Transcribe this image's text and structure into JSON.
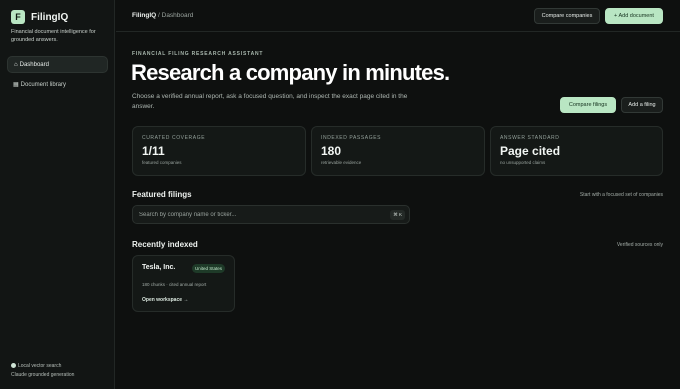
{
  "app": {
    "logo_letter": "F",
    "name": "FilingIQ",
    "tagline": "Financial document intelligence for grounded answers."
  },
  "sidebar": {
    "items": [
      {
        "icon": "⌂",
        "label": "Dashboard",
        "active": true
      },
      {
        "icon": "▦",
        "label": "Document library",
        "active": false
      }
    ],
    "footer": {
      "line1": "Local vector search",
      "line2": "Claude grounded generation"
    }
  },
  "topbar": {
    "breadcrumb_root": "FilingIQ",
    "breadcrumb_sep": " / ",
    "breadcrumb_page": "Dashboard",
    "compare_label": "Compare companies",
    "add_label": "+ Add document"
  },
  "hero": {
    "eyebrow": "FINANCIAL FILING RESEARCH ASSISTANT",
    "title": "Research a company in minutes.",
    "subtitle": "Choose a verified annual report, ask a focused question, and inspect the exact page cited in the answer.",
    "compare_filings_label": "Compare filings",
    "add_filing_label": "Add a filing"
  },
  "stats": [
    {
      "label": "CURATED COVERAGE",
      "value": "1/11",
      "note": "featured companies"
    },
    {
      "label": "INDEXED PASSAGES",
      "value": "180",
      "note": "retrievable evidence"
    },
    {
      "label": "ANSWER STANDARD",
      "value": "Page cited",
      "note": "no unsupported claims"
    }
  ],
  "featured": {
    "title": "Featured filings",
    "aside": "Start with a focused set of companies",
    "search_placeholder": "Search by company name or ticker...",
    "search_value": "",
    "shortcut": "⌘ K"
  },
  "recent": {
    "title": "Recently indexed",
    "aside": "Verified sources only",
    "items": [
      {
        "name": "Tesla, Inc.",
        "badge": "United States",
        "meta": "180 chunks · cited annual report",
        "link": "Open workspace →"
      }
    ]
  },
  "colors": {
    "accent": "#b9e6c3",
    "background": "#0e100f",
    "sidebar": "#121514",
    "card": "#141816"
  }
}
